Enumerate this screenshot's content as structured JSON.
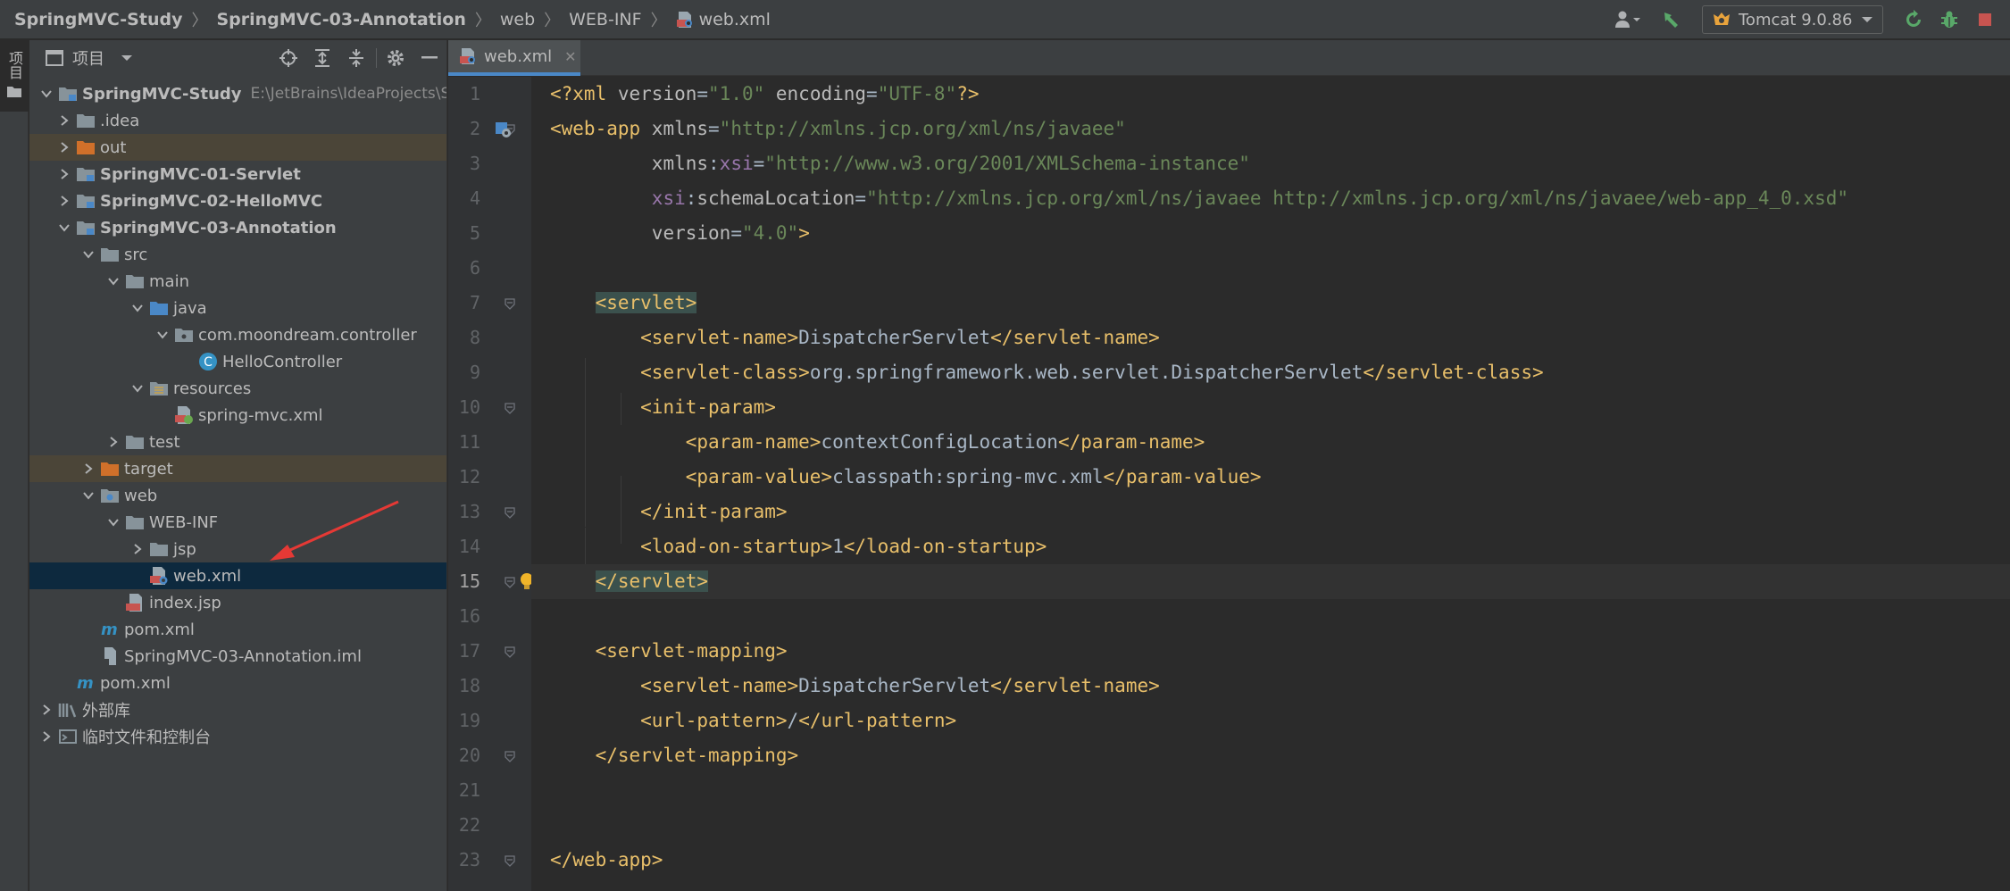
{
  "breadcrumbs": [
    "SpringMVC-Study",
    "SpringMVC-03-Annotation",
    "web",
    "WEB-INF",
    "web.xml"
  ],
  "run_config": "Tomcat 9.0.86",
  "tool_strip_label": "项目",
  "project_panel": {
    "title": "项目",
    "tree": [
      {
        "label": "SpringMVC-Study",
        "path": "E:\\JetBrains\\IdeaProjects\\Sp",
        "icon": "module-folder-icon"
      },
      {
        "label": ".idea",
        "icon": "folder-icon"
      },
      {
        "label": "out",
        "icon": "excluded-folder-icon"
      },
      {
        "label": "SpringMVC-01-Servlet",
        "icon": "module-folder-icon"
      },
      {
        "label": "SpringMVC-02-HelloMVC",
        "icon": "module-folder-icon"
      },
      {
        "label": "SpringMVC-03-Annotation",
        "icon": "module-folder-icon"
      },
      {
        "label": "src",
        "icon": "folder-icon"
      },
      {
        "label": "main",
        "icon": "folder-icon"
      },
      {
        "label": "java",
        "icon": "source-folder-icon"
      },
      {
        "label": "com.moondream.controller",
        "icon": "package-icon"
      },
      {
        "label": "HelloController",
        "icon": "class-icon"
      },
      {
        "label": "resources",
        "icon": "resources-folder-icon"
      },
      {
        "label": "spring-mvc.xml",
        "icon": "spring-xml-icon"
      },
      {
        "label": "test",
        "icon": "folder-icon"
      },
      {
        "label": "target",
        "icon": "excluded-folder-icon"
      },
      {
        "label": "web",
        "icon": "web-folder-icon"
      },
      {
        "label": "WEB-INF",
        "icon": "folder-icon"
      },
      {
        "label": "jsp",
        "icon": "folder-icon"
      },
      {
        "label": "web.xml",
        "icon": "web-xml-icon"
      },
      {
        "label": "index.jsp",
        "icon": "jsp-icon"
      },
      {
        "label": "pom.xml",
        "icon": "maven-icon"
      },
      {
        "label": "SpringMVC-03-Annotation.iml",
        "icon": "iml-icon"
      },
      {
        "label": "pom.xml",
        "icon": "maven-icon"
      },
      {
        "label": "外部库",
        "icon": "library-icon"
      },
      {
        "label": "临时文件和控制台",
        "icon": "scratches-icon"
      }
    ]
  },
  "editor": {
    "tab_label": "web.xml",
    "current_line": 15,
    "line_numbers": [
      "1",
      "2",
      "3",
      "4",
      "5",
      "6",
      "7",
      "8",
      "9",
      "10",
      "11",
      "12",
      "13",
      "14",
      "15",
      "16",
      "17",
      "18",
      "19",
      "20",
      "21",
      "22",
      "23"
    ]
  },
  "colors": {
    "background": "#2b2b2b",
    "panel": "#3c3f41",
    "tag": "#e8bf6a",
    "string": "#6a8759",
    "namespace": "#9876aa",
    "selection": "#0d293e"
  }
}
